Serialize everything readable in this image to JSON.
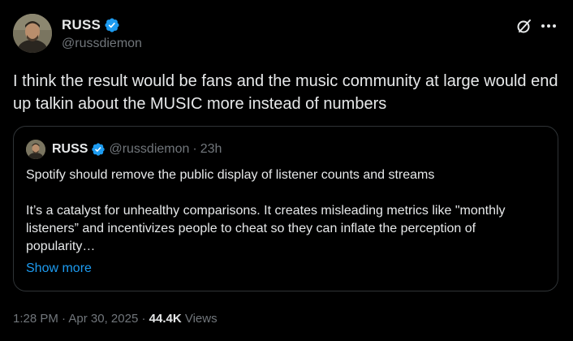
{
  "author": {
    "name": "RUSS",
    "handle": "@russdiemon",
    "verified": true,
    "badge_color": "#1d9bf0"
  },
  "header_icons": [
    "grok-icon",
    "more-icon"
  ],
  "tweet": {
    "text": "I think the result would be fans and the music community at large would end up talkin about the MUSIC more instead of numbers"
  },
  "quote": {
    "name": "RUSS",
    "handle": "@russdiemon",
    "separator": "·",
    "time": "23h",
    "paragraph_1": "Spotify should remove the public display of listener counts and streams",
    "paragraph_2": "It’s a catalyst for unhealthy comparisons. It creates misleading metrics like \"monthly listeners” and incentivizes people to cheat so they can inflate the perception of popularity…",
    "show_more": "Show more"
  },
  "meta": {
    "time": "1:28 PM",
    "separator": "·",
    "date": "Apr 30, 2025",
    "views_count": "44.4K",
    "views_label": "Views"
  },
  "colors": {
    "background": "#000000",
    "text_primary": "#e7e9ea",
    "text_secondary": "#71767b",
    "link": "#1d9bf0",
    "border": "#2f3336"
  }
}
